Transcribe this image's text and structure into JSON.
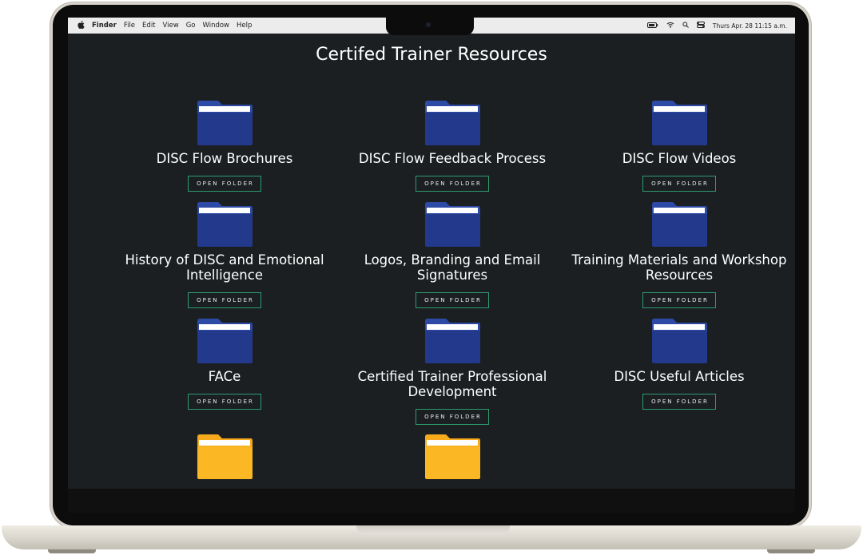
{
  "menubar": {
    "apple_icon": "apple-icon",
    "items": [
      "Finder",
      "File",
      "Edit",
      "View",
      "Go",
      "Window",
      "Help"
    ],
    "status_icons": [
      "battery-icon",
      "wifi-icon",
      "search-icon",
      "control-center-icon"
    ],
    "clock": "Thurs Apr. 28  11:15 a.m."
  },
  "page": {
    "title": "Certifed Trainer Resources"
  },
  "colors": {
    "background": "#1b1f22",
    "folder_blue": "#233a8c",
    "folder_yellow": "#fbb824",
    "button_border": "#2f9b6e"
  },
  "folders": [
    {
      "title": "DISC Flow Brochures",
      "button": "OPEN FOLDER",
      "color": "blue"
    },
    {
      "title": "DISC Flow Feedback Process",
      "button": "OPEN FOLDER",
      "color": "blue"
    },
    {
      "title": "DISC Flow Videos",
      "button": "OPEN FOLDER",
      "color": "blue"
    },
    {
      "title": "History of DISC and Emotional Intelligence",
      "button": "OPEN FOLDER",
      "color": "blue"
    },
    {
      "title": "Logos, Branding and Email Signatures",
      "button": "OPEN FOLDER",
      "color": "blue"
    },
    {
      "title": "Training Materials and Workshop Resources",
      "button": "OPEN FOLDER",
      "color": "blue"
    },
    {
      "title": "FACe",
      "button": "OPEN FOLDER",
      "color": "blue"
    },
    {
      "title": "Certified Trainer Professional Development",
      "button": "OPEN FOLDER",
      "color": "blue"
    },
    {
      "title": "DISC Useful Articles",
      "button": "OPEN FOLDER",
      "color": "blue"
    },
    {
      "color": "yellow"
    },
    {
      "color": "yellow"
    }
  ]
}
